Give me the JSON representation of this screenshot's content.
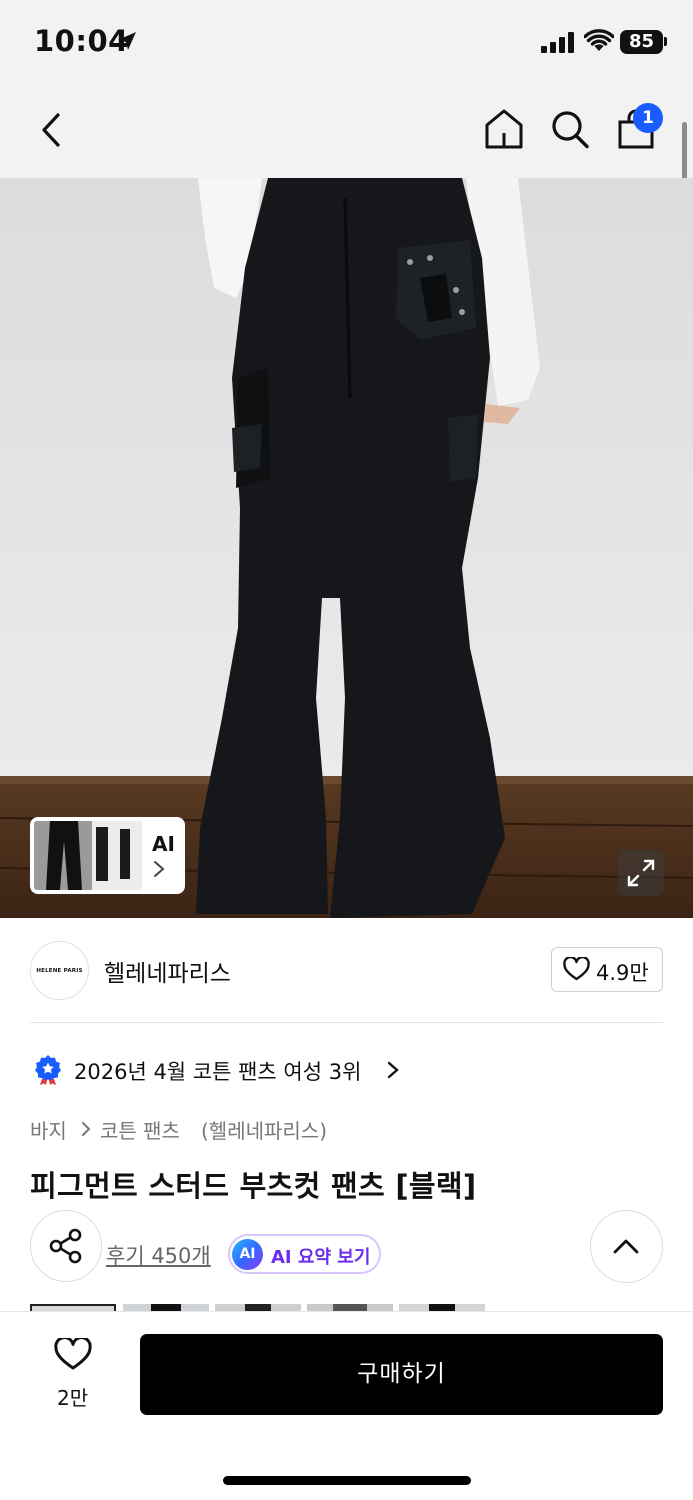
{
  "status_bar": {
    "time": "10:04",
    "battery": "85"
  },
  "nav": {
    "cart_count": "1"
  },
  "hero": {
    "thumbnail_label": "AI"
  },
  "brand": {
    "logo_text": "HELENE PARIS",
    "name": "헬레네파리스",
    "likes": "4.9만"
  },
  "ranking": {
    "text": "2026년 4월 코튼 팬츠 여성 3위"
  },
  "breadcrumb": {
    "level1": "바지",
    "level2": "코튼 팬츠",
    "brand": "(헬레네파리스)"
  },
  "product": {
    "title": "피그먼트 스터드 부츠컷 팬츠 [블랙]",
    "reviews": "후기 450개",
    "ai_badge": "AI",
    "ai_summary": "AI 요약 보기"
  },
  "bottom_bar": {
    "wish_count": "2만",
    "buy_label": "구매하기"
  },
  "colors": {
    "accent": "#1a5cff",
    "ai_purple": "#6b2ef0",
    "buy_button": "#000000"
  }
}
